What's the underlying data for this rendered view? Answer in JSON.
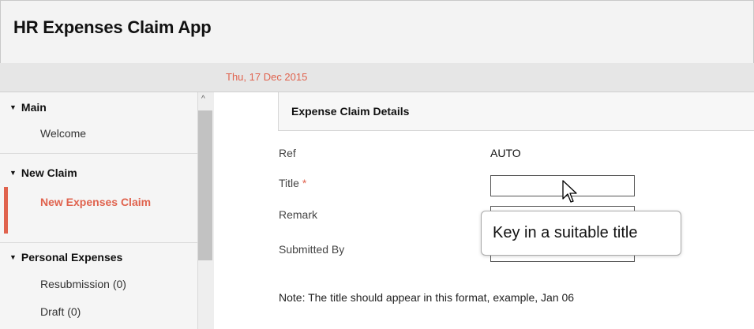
{
  "app": {
    "title": "HR Expenses Claim App"
  },
  "subbar": {
    "date": "Thu, 17 Dec 2015"
  },
  "sidebar": {
    "sections": [
      {
        "title": "Main",
        "items": [
          {
            "label": "Welcome"
          }
        ]
      },
      {
        "title": "New Claim",
        "items": [
          {
            "label": "New Expenses Claim",
            "active": true
          }
        ]
      },
      {
        "title": "Personal Expenses",
        "items": [
          {
            "label": "Resubmission (0)"
          },
          {
            "label": "Draft (0)"
          }
        ]
      }
    ]
  },
  "panel": {
    "title": "Expense Claim Details",
    "fields": [
      {
        "label": "Ref",
        "value": "AUTO"
      },
      {
        "label": "Title",
        "required_mark": "*",
        "value": ""
      },
      {
        "label": "Remark",
        "value": ""
      },
      {
        "label": "Submitted By",
        "value": ""
      }
    ],
    "tooltip": "Key in a suitable title",
    "note": "Note: The title should appear in this format, example, Jan 06"
  },
  "colors": {
    "accent": "#e0634e",
    "header_bg": "#f3f3f3",
    "subbar_bg": "#e6e6e6"
  },
  "icons": {
    "section_toggle": "triangle-down-icon",
    "scroll_up": "chevron-up-icon",
    "pointer": "mouse-pointer-icon"
  }
}
